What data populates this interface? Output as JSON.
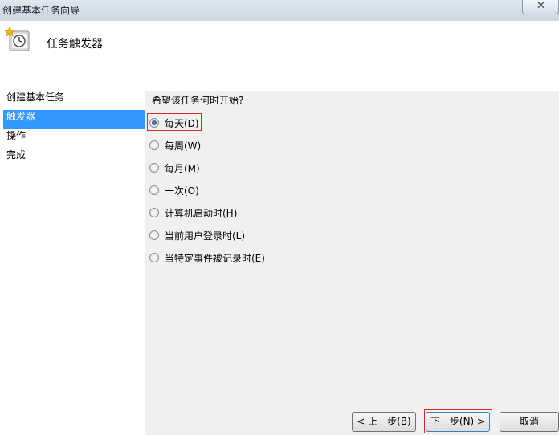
{
  "window": {
    "title": "创建基本任务向导"
  },
  "header": {
    "title": "任务触发器",
    "icon": "task-clock-icon"
  },
  "steps": [
    {
      "label": "创建基本任务"
    },
    {
      "label": "触发器",
      "active": true
    },
    {
      "label": "操作"
    },
    {
      "label": "完成"
    }
  ],
  "trigger": {
    "prompt": "希望该任务何时开始?",
    "options": [
      {
        "label": "每天(D)",
        "selected": true
      },
      {
        "label": "每周(W)"
      },
      {
        "label": "每月(M)"
      },
      {
        "label": "一次(O)"
      },
      {
        "label": "计算机启动时(H)"
      },
      {
        "label": "当前用户登录时(L)"
      },
      {
        "label": "当特定事件被记录时(E)"
      }
    ]
  },
  "buttons": {
    "back": "< 上一步(B)",
    "next": "下一步(N) >",
    "cancel": "取消"
  },
  "colors": {
    "selection": "#3399ff",
    "highlight_box": "#e0262a"
  }
}
